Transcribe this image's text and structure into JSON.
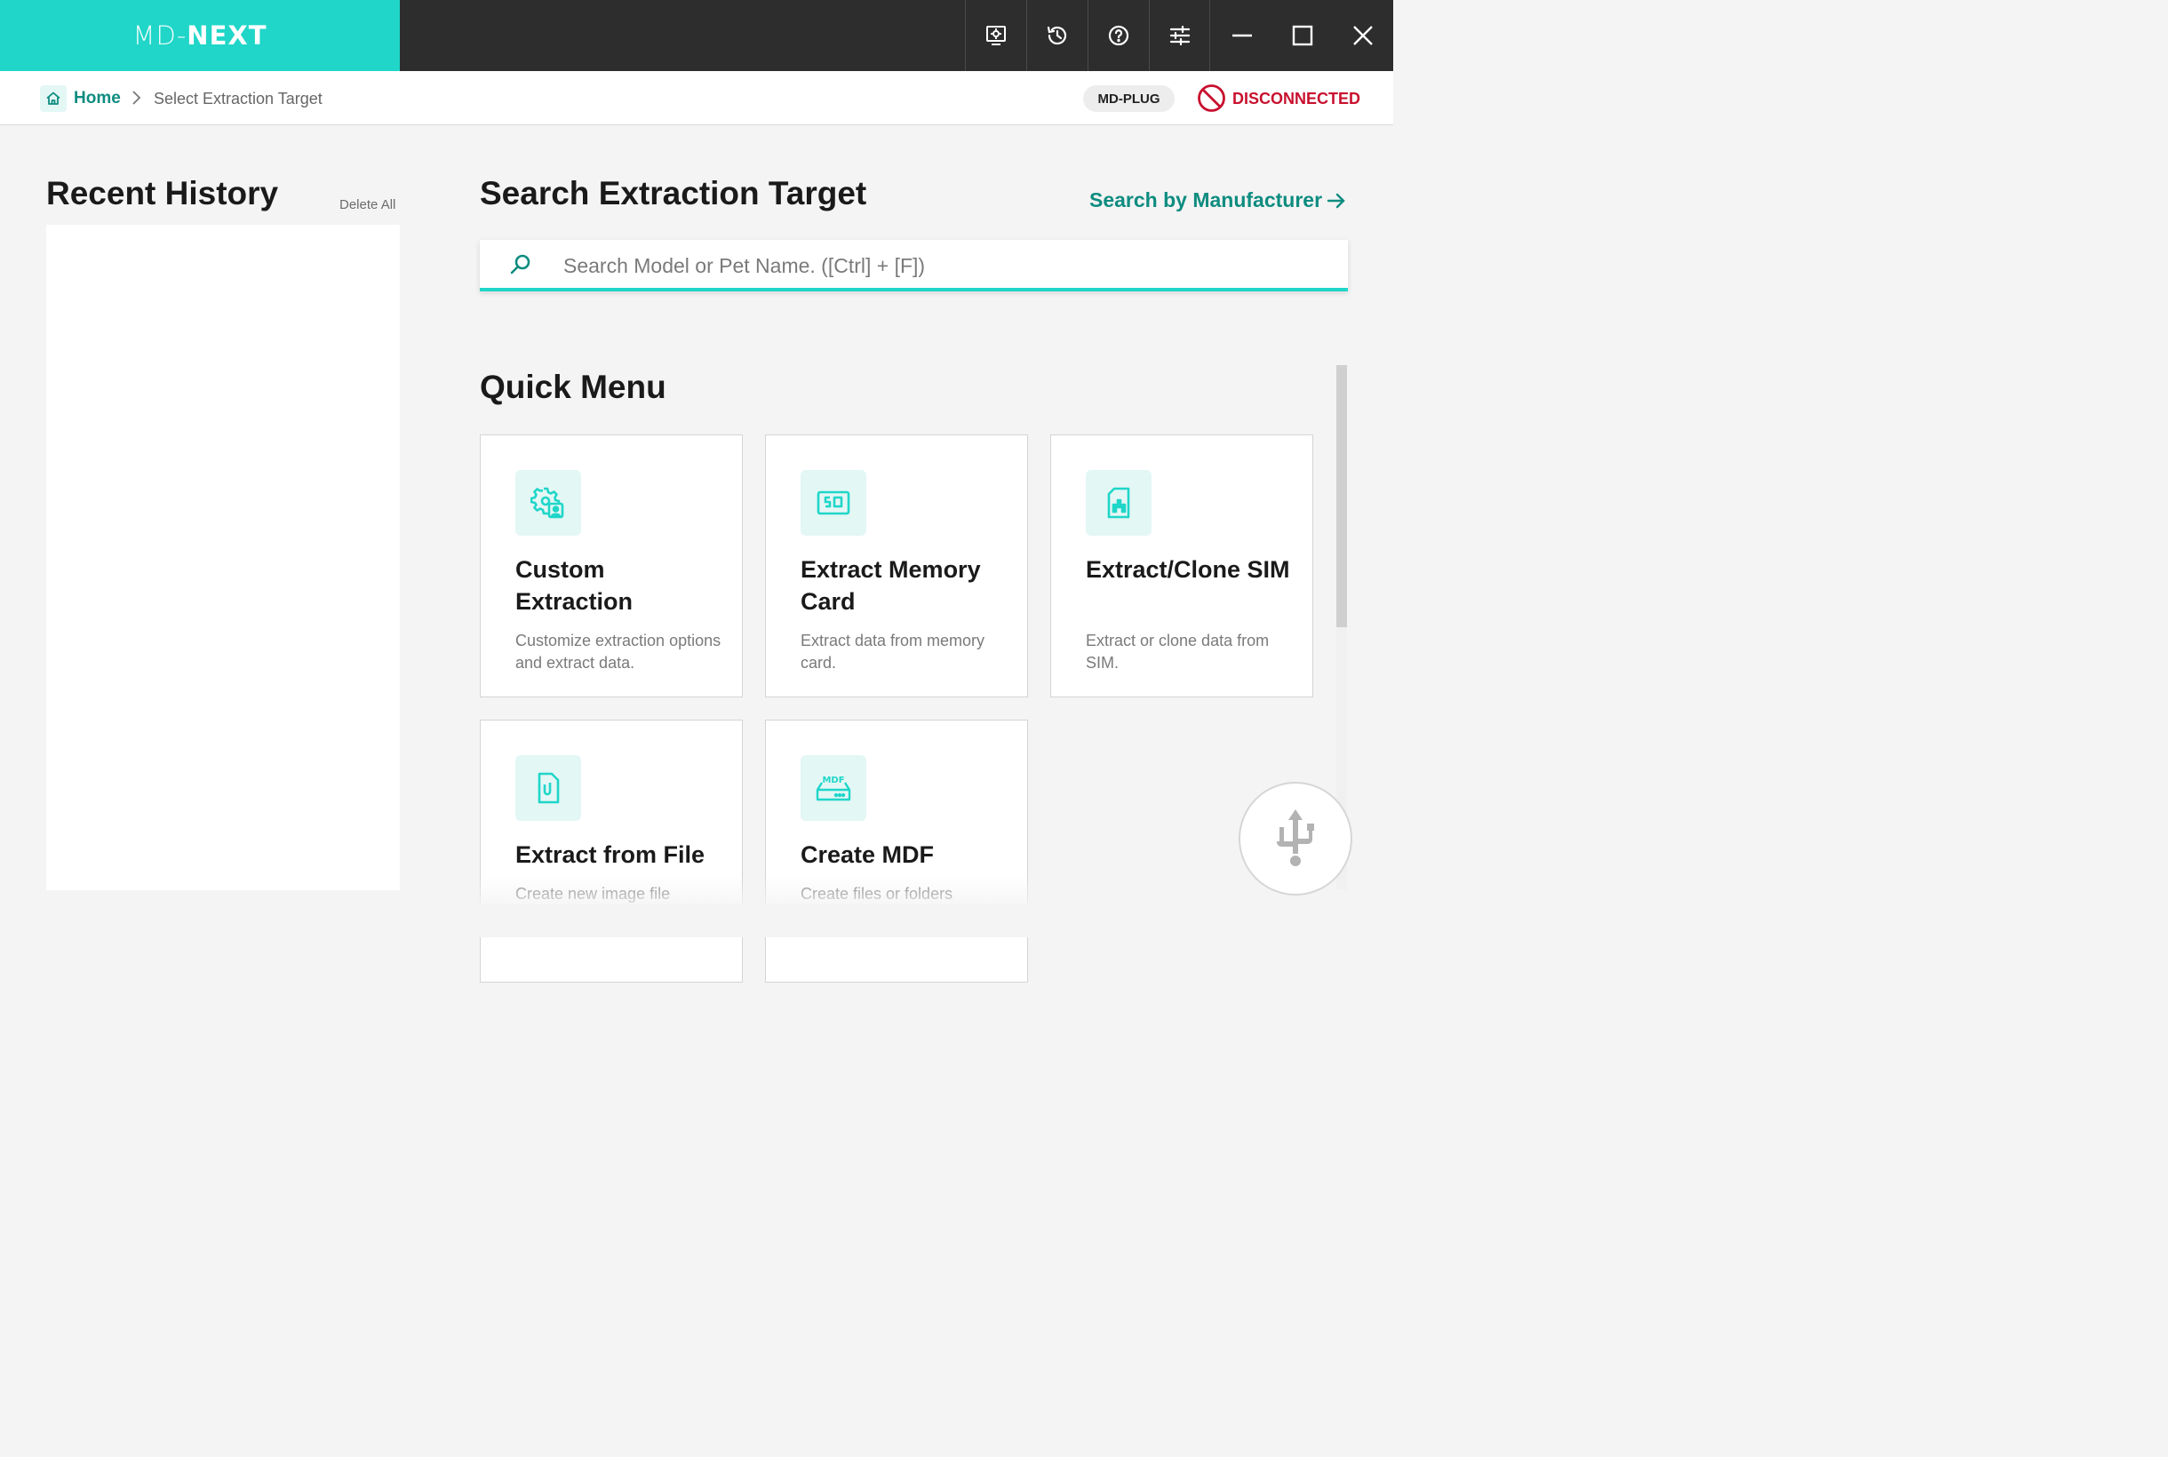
{
  "app": {
    "brand_light": "MD-",
    "brand_bold": "NEXT",
    "accent_color": "#1fd6c8",
    "accent_dark": "#0e8c80",
    "titlebar_color": "#2d2d2d"
  },
  "toolbar": {
    "tools": [
      "screen-capture-icon",
      "history-icon",
      "help-icon",
      "settings-sliders-icon"
    ],
    "window_controls": [
      "minimize-icon",
      "maximize-icon",
      "close-icon"
    ]
  },
  "breadcrumb": {
    "home_label": "Home",
    "current": "Select Extraction Target"
  },
  "connection": {
    "device_badge": "MD-PLUG",
    "status": "DISCONNECTED",
    "status_color": "#c8102e"
  },
  "recent_history": {
    "title": "Recent History",
    "delete_all": "Delete All"
  },
  "search": {
    "title": "Search Extraction Target",
    "by_manufacturer": "Search by Manufacturer",
    "placeholder": "Search Model or Pet Name. ([Ctrl] + [F])"
  },
  "quick_menu": {
    "title": "Quick Menu",
    "cards": [
      {
        "title": "Custom Extraction",
        "desc": "Customize extraction options and extract data.",
        "icon": "gear-user-icon"
      },
      {
        "title": "Extract Memory Card",
        "desc": "Extract data from memory card.",
        "icon": "sd-card-icon"
      },
      {
        "title": "Extract/Clone SIM",
        "desc": "Extract or clone data from SIM.",
        "icon": "sim-card-icon"
      },
      {
        "title": "Extract from File",
        "desc": "Create new image file",
        "icon": "file-clip-icon"
      },
      {
        "title": "Create MDF",
        "desc": "Create files or folders",
        "icon": "mdf-drive-icon"
      }
    ]
  },
  "floating": {
    "usb_button": "usb-icon"
  }
}
